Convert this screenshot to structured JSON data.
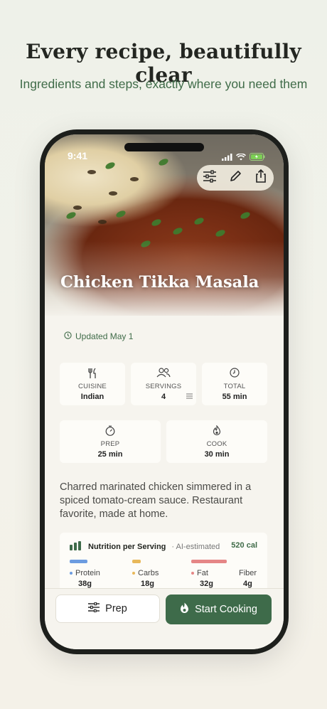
{
  "header": {
    "title": "Every recipe, beautifully clear",
    "subtitle": "Ingredients and steps, exactly where you need them"
  },
  "status_bar": {
    "time": "9:41"
  },
  "recipe": {
    "title": "Chicken Tikka Masala",
    "updated": "Updated May 1",
    "stats": {
      "cuisine": {
        "label": "CUISINE",
        "value": "Indian"
      },
      "servings": {
        "label": "SERVINGS",
        "value": "4"
      },
      "total": {
        "label": "TOTAL",
        "value": "55 min"
      },
      "prep": {
        "label": "PREP",
        "value": "25 min"
      },
      "cook": {
        "label": "COOK",
        "value": "30 min"
      }
    },
    "description": "Charred marinated chicken simmered in a spiced tomato-cream sauce. Restaurant favorite, made at home."
  },
  "nutrition": {
    "title": "Nutrition per Serving",
    "ai_note": "· AI-estimated",
    "calories": "520 cal",
    "macros": [
      {
        "name": "Protein",
        "amount": "38g",
        "color": "#6c9ce0"
      },
      {
        "name": "Carbs",
        "amount": "18g",
        "color": "#e8b85a"
      },
      {
        "name": "Fat",
        "amount": "32g",
        "color": "#e58686"
      },
      {
        "name": "Fiber",
        "amount": "4g",
        "color": "#ffffff"
      }
    ]
  },
  "actions": {
    "prep_label": "Prep",
    "cook_label": "Start Cooking"
  },
  "colors": {
    "accent_green": "#3e6b4a",
    "subtitle_green": "#3f6b48"
  }
}
